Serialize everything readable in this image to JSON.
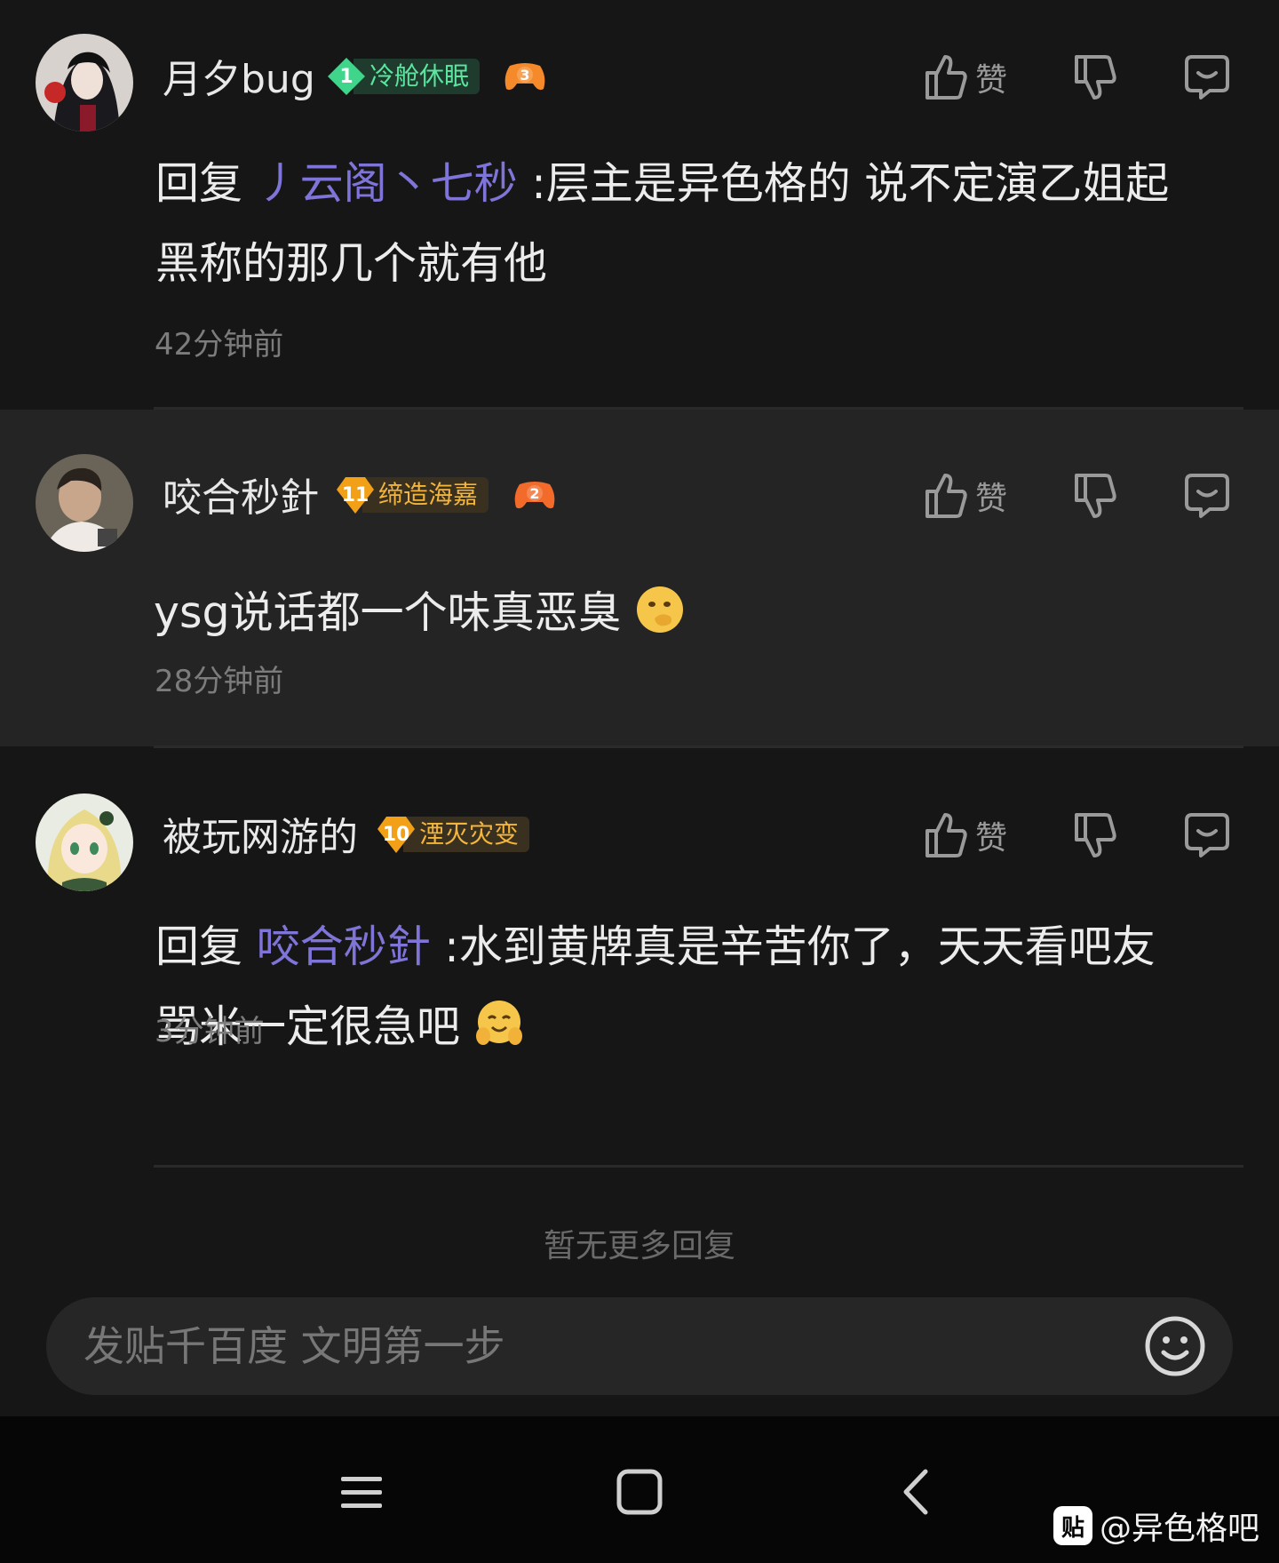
{
  "comments": [
    {
      "username": "月夕bug",
      "level": "1",
      "level_title": "冷舱休眠",
      "game_level": "3",
      "like_label": "赞",
      "reply_prefix": "回复",
      "mention": "丿云阁丶七秒",
      "text_line1": ":层主是异色格的 说不定演乙姐起",
      "text_line2": "黑称的那几个就有他",
      "time": "42分钟前"
    },
    {
      "username": "咬合秒針",
      "level": "11",
      "level_title": "缔造海嘉",
      "game_level": "2",
      "like_label": "赞",
      "text": "ysg说话都一个味真恶臭",
      "emoji": "smirk-emoji",
      "time": "28分钟前"
    },
    {
      "username": "被玩网游的",
      "level": "10",
      "level_title": "湮灭灾变",
      "like_label": "赞",
      "reply_prefix": "回复",
      "mention": "咬合秒針",
      "text_line1": ":水到黄牌真是辛苦你了，天天看吧友",
      "text_line2": "骂米一定很急吧",
      "emoji": "hug-emoji",
      "time": "3分钟前"
    }
  ],
  "no_more_replies": "暂无更多回复",
  "input": {
    "placeholder": "发贴千百度 文明第一步"
  },
  "watermark": {
    "logo": "贴",
    "text": "@异色格吧"
  },
  "colors": {
    "mention": "#7f74d8",
    "badge_green": "#3fd58a",
    "badge_orange": "#f2a018",
    "background": "#161616",
    "highlight_row": "#242425"
  }
}
